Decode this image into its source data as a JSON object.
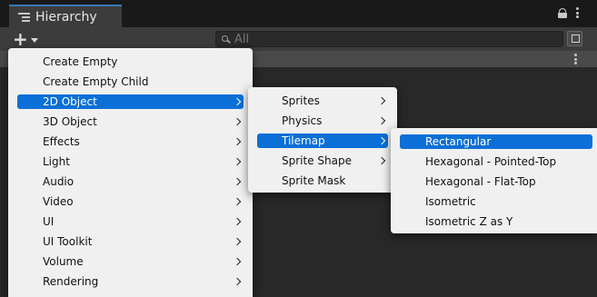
{
  "window": {
    "tab_title": "Hierarchy"
  },
  "toolbar": {
    "search_placeholder": "All"
  },
  "menu_main": {
    "items": [
      {
        "label": "Create Empty",
        "submenu": false
      },
      {
        "label": "Create Empty Child",
        "submenu": false
      },
      {
        "label": "2D Object",
        "submenu": true,
        "selected": true
      },
      {
        "label": "3D Object",
        "submenu": true
      },
      {
        "label": "Effects",
        "submenu": true
      },
      {
        "label": "Light",
        "submenu": true
      },
      {
        "label": "Audio",
        "submenu": true
      },
      {
        "label": "Video",
        "submenu": true
      },
      {
        "label": "UI",
        "submenu": true
      },
      {
        "label": "UI Toolkit",
        "submenu": true
      },
      {
        "label": "Volume",
        "submenu": true
      },
      {
        "label": "Rendering",
        "submenu": true
      }
    ]
  },
  "menu_2d": {
    "items": [
      {
        "label": "Sprites",
        "submenu": true
      },
      {
        "label": "Physics",
        "submenu": true
      },
      {
        "label": "Tilemap",
        "submenu": true,
        "selected": true
      },
      {
        "label": "Sprite Shape",
        "submenu": true
      },
      {
        "label": "Sprite Mask",
        "submenu": false
      }
    ]
  },
  "menu_tilemap": {
    "items": [
      {
        "label": "Rectangular",
        "selected": true
      },
      {
        "label": "Hexagonal - Pointed-Top"
      },
      {
        "label": "Hexagonal - Flat-Top"
      },
      {
        "label": "Isometric"
      },
      {
        "label": "Isometric Z as Y"
      }
    ]
  },
  "colors": {
    "highlight": "#0a6fd6",
    "tab_accent": "#3a79bb",
    "menu_bg": "#f0f0f0"
  }
}
